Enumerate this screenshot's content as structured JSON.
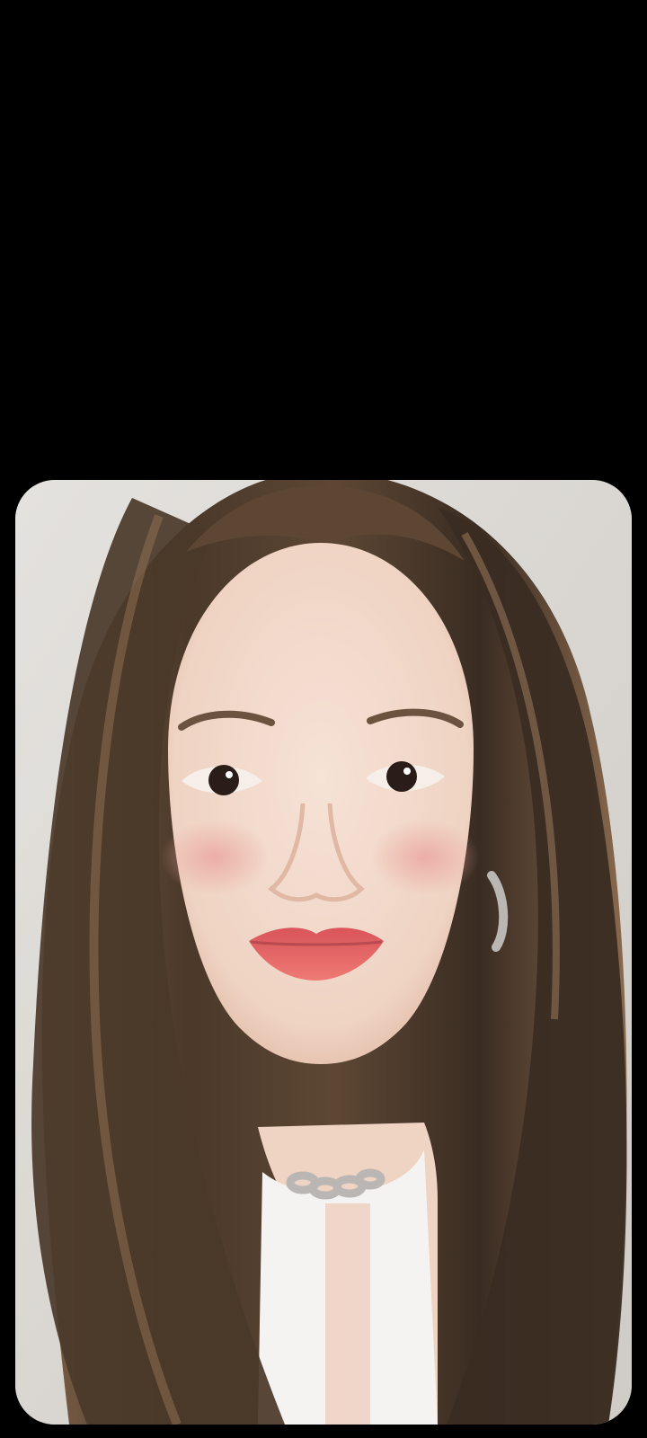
{
  "screen": {
    "background_color": "#000000"
  },
  "photo": {
    "subject_icon": "portrait-photo",
    "colors": {
      "wall": "#d9d6d2",
      "hair_dark": "#3a2c22",
      "hair_mid": "#6b5340",
      "hair_light": "#9a7a5c",
      "skin": "#f3dccf",
      "skin_shadow": "#e7c6b4",
      "blush": "#eeb4ad",
      "lips": "#e4676a",
      "eyes": "#2a1c18",
      "shirt": "#f4f3f1",
      "chain": "#b9b6b3"
    }
  }
}
